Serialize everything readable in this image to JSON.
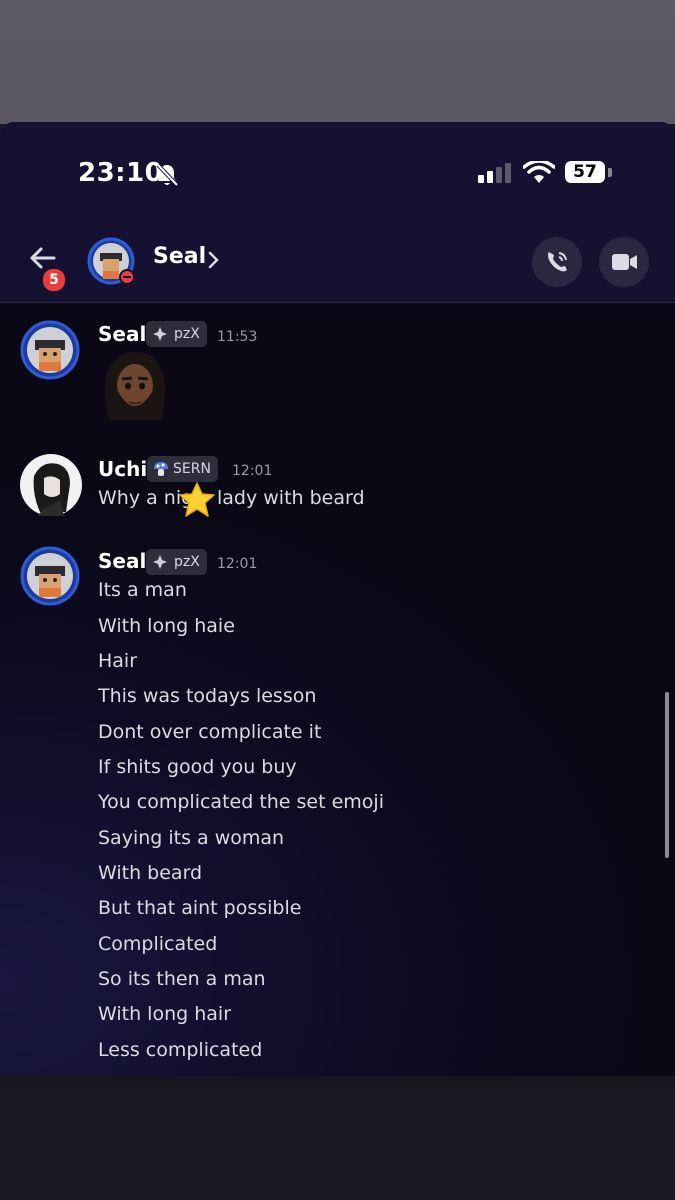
{
  "status_bar": {
    "time": "23:10",
    "battery": "57"
  },
  "header": {
    "badge_count": "5",
    "contact_name": "Seal"
  },
  "messages": [
    {
      "author": "Seal",
      "tag": "pzX",
      "time": "11:53",
      "emoji": "beard-person-emoji"
    },
    {
      "author": "Uchi",
      "tag": "SERN",
      "time": "12:01",
      "lines": [
        "Why a nig",
        "lady with beard"
      ]
    },
    {
      "author": "Seal",
      "tag": "pzX",
      "time": "12:01",
      "lines": [
        "Its a man",
        "With long haie",
        "Hair",
        "This was todays lesson",
        "Dont over complicate it",
        "If shits good you buy",
        "You complicated the set emoji",
        "Saying its a woman",
        "With beard",
        "But that aint possible",
        "Complicated",
        "So its then a man",
        "With long hair",
        "Less complicated"
      ]
    }
  ],
  "colors": {
    "badge": "#e63d3d",
    "avatar_ring": "#2f5bd8",
    "dnd": "#e63d3d"
  }
}
